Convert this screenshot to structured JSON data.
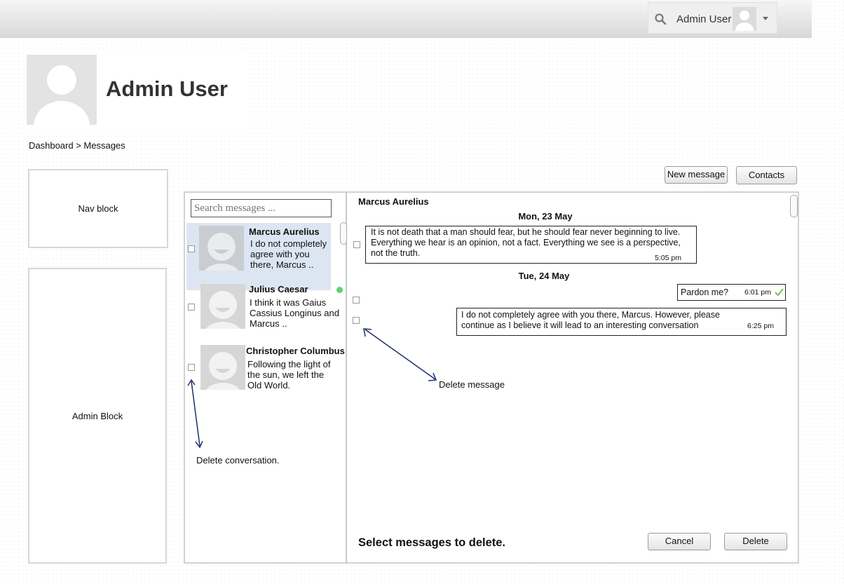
{
  "header": {
    "user_name": "Admin User",
    "icons": {
      "search": "search-icon",
      "avatar": "user-avatar",
      "menu": "chevron-down-icon"
    }
  },
  "profile": {
    "name": "Admin User"
  },
  "breadcrumb": "Dashboard > Messages",
  "blocks": {
    "nav": "Nav block",
    "admin": "Admin Block"
  },
  "toolbar": {
    "new_message": "New message",
    "contacts": "Contacts"
  },
  "search": {
    "placeholder": "Search messages ..."
  },
  "conversations": [
    {
      "name": "Marcus Aurelius",
      "preview": "I do not completely agree with you there, Marcus ..",
      "selected": true,
      "online": false
    },
    {
      "name": "Julius Caesar",
      "preview": "I think it was Gaius Cassius Longinus and Marcus ..",
      "selected": false,
      "online": true
    },
    {
      "name": "Christopher Columbus",
      "preview": "Following the light of the sun, we left the Old World.",
      "selected": false,
      "online": false
    }
  ],
  "thread": {
    "title": "Marcus Aurelius",
    "days": [
      {
        "date": "Mon, 23 May",
        "messages": [
          {
            "text": "It is not death that a man should fear, but he should fear never beginning to live. Everything we hear is an opinion, not a fact. Everything we see is a perspective, not the truth.",
            "time": "5:05 pm",
            "outgoing": false
          }
        ]
      },
      {
        "date": "Tue, 24 May",
        "messages": [
          {
            "text": "Pardon me?",
            "time": "6:01 pm",
            "outgoing": true,
            "read": true
          },
          {
            "text": "I do not completely agree with you there, Marcus. However, please continue as I believe it will lead to an interesting conversation",
            "time": "6:25 pm",
            "outgoing": true
          }
        ]
      }
    ]
  },
  "annotations": {
    "delete_message": "Delete message",
    "delete_conversation": "Delete conversation."
  },
  "footer": {
    "prompt": "Select messages to delete.",
    "cancel": "Cancel",
    "delete": "Delete"
  },
  "colors": {
    "selected_row": "#dce6f2",
    "online": "#5fd26f",
    "annotation_arrow": "#1f2f6b",
    "read_check": "#7cc14a"
  }
}
